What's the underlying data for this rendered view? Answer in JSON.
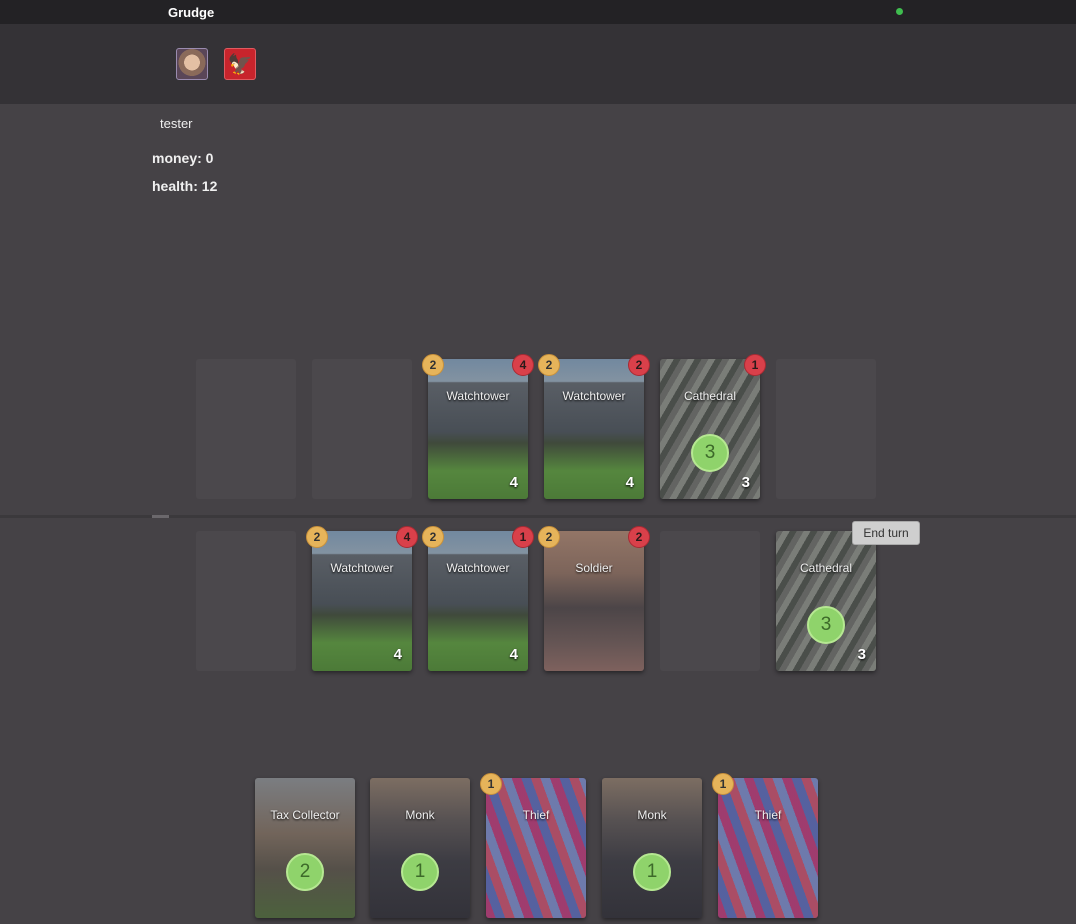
{
  "app": {
    "title": "Grudge",
    "status_color": "#3fbd4f"
  },
  "player": {
    "name": "tester",
    "money": "money: 0",
    "health": "health: 12"
  },
  "icons": {
    "user_avatar": "avatar-photo-icon",
    "emblem": "polish-eagle-icon"
  },
  "opponent_board": [
    {
      "name": "Watchtower",
      "cost": "2",
      "attack": "4",
      "health": "4",
      "value": ""
    },
    {
      "name": "Watchtower",
      "cost": "2",
      "attack": "2",
      "health": "4",
      "value": ""
    },
    {
      "name": "Cathedral",
      "cost": "",
      "attack": "1",
      "health": "3",
      "value": "3"
    }
  ],
  "player_board": [
    {
      "name": "Watchtower",
      "cost": "2",
      "attack": "4",
      "health": "4",
      "value": ""
    },
    {
      "name": "Watchtower",
      "cost": "2",
      "attack": "1",
      "health": "4",
      "value": ""
    },
    {
      "name": "Soldier",
      "cost": "2",
      "attack": "2",
      "health": "",
      "value": ""
    },
    {
      "name": "Cathedral",
      "cost": "",
      "attack": "",
      "health": "3",
      "value": "3"
    }
  ],
  "hand": [
    {
      "name": "Tax Collector",
      "cost": "",
      "value": "2"
    },
    {
      "name": "Monk",
      "cost": "",
      "value": "1"
    },
    {
      "name": "Thief",
      "cost": "1",
      "value": ""
    },
    {
      "name": "Monk",
      "cost": "",
      "value": "1"
    },
    {
      "name": "Thief",
      "cost": "1",
      "value": ""
    }
  ],
  "actions": {
    "end_turn": "End turn"
  }
}
